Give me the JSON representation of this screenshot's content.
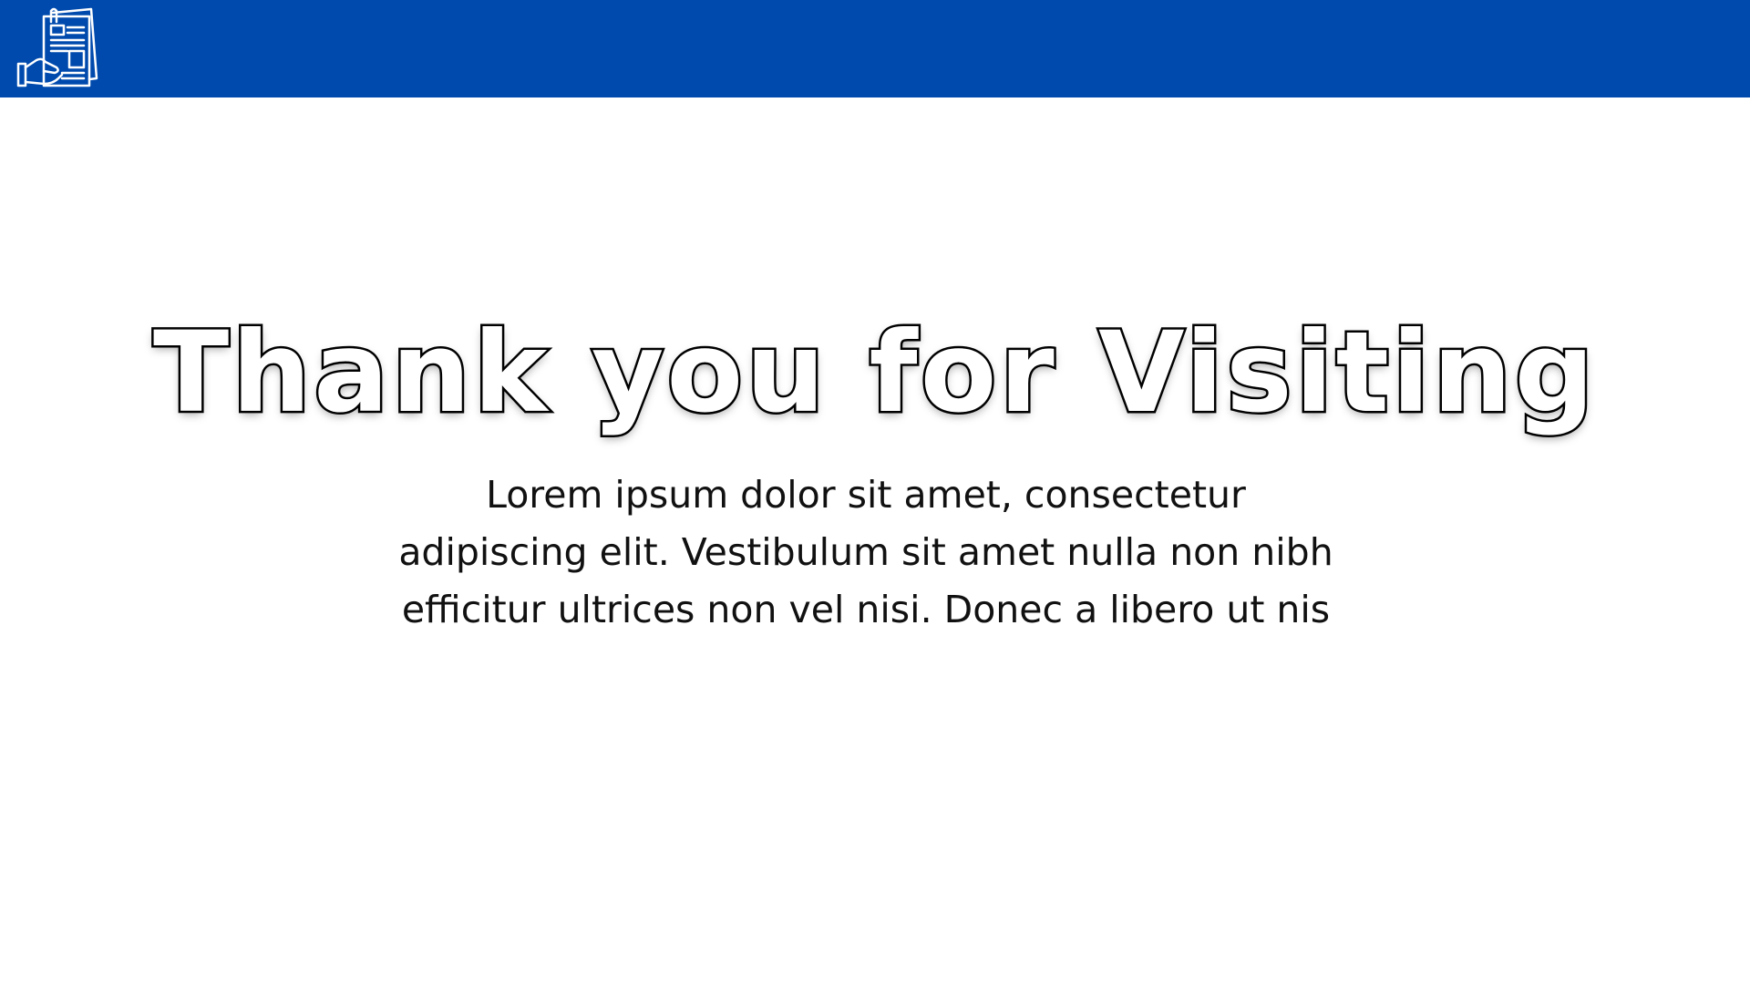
{
  "header": {
    "logo_icon": "document-hand-icon",
    "bar_color": "#004aad"
  },
  "main": {
    "title": "Thank you for Visiting",
    "body": "Lorem ipsum dolor sit amet, consectetur adipiscing elit. Vestibulum sit amet nulla non nibh efficitur ultrices non vel nisi. Donec a libero ut nis"
  }
}
